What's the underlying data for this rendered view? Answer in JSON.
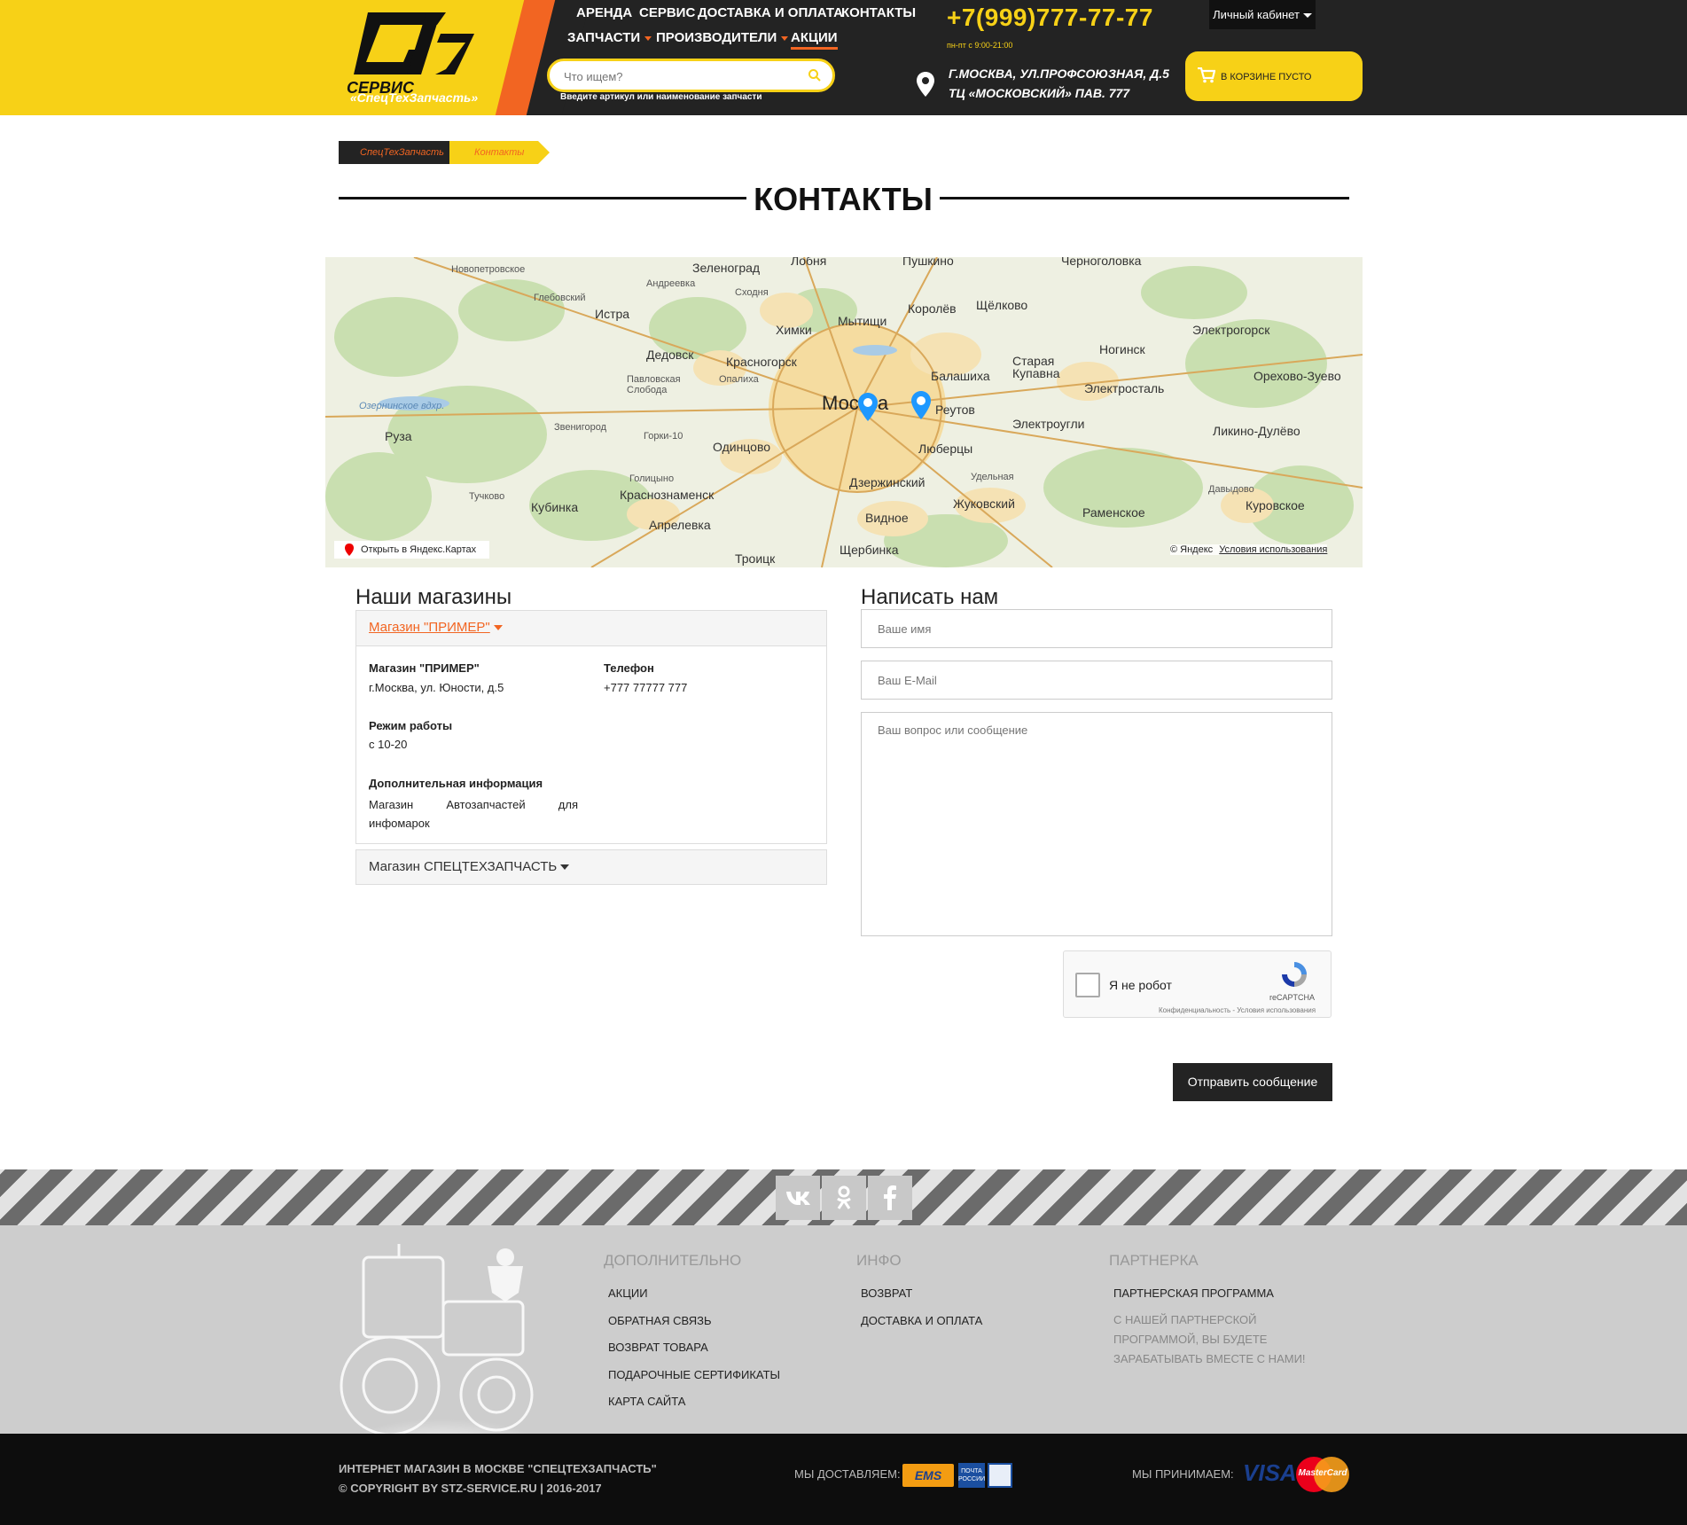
{
  "header": {
    "logo_sub": "«СпецТехЗапчасть»",
    "nav_row1": [
      "АРЕНДА",
      "СЕРВИС",
      "ДОСТАВКА И ОПЛАТА",
      "КОНТАКТЫ"
    ],
    "nav_row2": [
      "ЗАПЧАСТИ",
      "ПРОИЗВОДИТЕЛИ",
      "АКЦИИ"
    ],
    "search_placeholder": "Что ищем?",
    "search_hint": "Введите артикул или наименование запчасти",
    "phone": "+7(999)777-77-77",
    "hours": "пн-пт с 9:00-21:00",
    "address_line1": "Г.МОСКВА, УЛ.ПРОФСОЮЗНАЯ, Д.5",
    "address_line2": "ТЦ «МОСКОВСКИЙ» ПАВ. 777",
    "cabinet": "Личный кабинет",
    "cart": "В КОРЗИНЕ ПУСТО"
  },
  "breadcrumb": [
    "СпецТехЗапчасть",
    "Контакты"
  ],
  "page_title": "КОНТАКТЫ",
  "map": {
    "labels": [
      "Зеленоград",
      "Лобня",
      "Пушкино",
      "Черноголовка",
      "Новопетровское",
      "Андреевка",
      "Сходня",
      "Щёлково",
      "Королёв",
      "Глебовский",
      "Истра",
      "Химки",
      "Мытищи",
      "Электрогорск",
      "Ногинск",
      "Дедовск",
      "Красногорск",
      "Старая Купавна",
      "Балашиха",
      "Орехово-Зуево",
      "Павловская Слобода",
      "Опалиха",
      "Москва",
      "Реутов",
      "Электросталь",
      "Озернинское вдхр.",
      "Руза",
      "Звенигород",
      "Горки-10",
      "Одинцово",
      "Люберцы",
      "Электроугли",
      "Ликино-Дулёво",
      "Голицыно",
      "Дзержинский",
      "Удельная",
      "Тучково",
      "Кубинка",
      "Краснознаменск",
      "Жуковский",
      "Раменское",
      "Куровское",
      "Апрелевка",
      "Видное",
      "Щербинка",
      "Троицк",
      "Давыдово"
    ],
    "open_link": "Открыть в Яндекс.Картах",
    "copyright": "© Яндекс",
    "terms": "Условия использования"
  },
  "stores": {
    "heading": "Наши магазины",
    "store1": {
      "title": "Магазин \"ПРИМЕР\"",
      "name_label": "Магазин \"ПРИМЕР\"",
      "address": "г.Москва, ул. Юности, д.5",
      "phone_label": "Телефон",
      "phone": "+777 77777 777",
      "hours_label": "Режим работы",
      "hours": "с 10-20",
      "info_label": "Дополнительная информация",
      "info": "Магазин Автозапчастей для инфомарок"
    },
    "store2": {
      "title": "Магазин СПЕЦТЕХЗАПЧАСТЬ"
    }
  },
  "form": {
    "heading": "Написать нам",
    "name_placeholder": "Ваше имя",
    "email_placeholder": "Ваш E-Mail",
    "message_placeholder": "Ваш вопрос или сообщение",
    "captcha_label": "Я не робот",
    "captcha_brand": "reCAPTCHA",
    "captcha_fine": "Конфиденциальность - Условия использования",
    "submit": "Отправить сообщение"
  },
  "footer": {
    "social": [
      "vk-icon",
      "odnoklassniki-icon",
      "facebook-icon"
    ],
    "col1": {
      "heading": "ДОПОЛНИТЕЛЬНО",
      "links": [
        "АКЦИИ",
        "ОБРАТНАЯ СВЯЗЬ",
        "ВОЗВРАТ ТОВАРА",
        "ПОДАРОЧНЫЕ СЕРТИФИКАТЫ",
        "КАРТА САЙТА"
      ]
    },
    "col2": {
      "heading": "ИНФО",
      "links": [
        "ВОЗВРАТ",
        "ДОСТАВКА И ОПЛАТА"
      ]
    },
    "col3": {
      "heading": "ПАРТНЕРКА",
      "links": [
        "ПАРТНЕРСКАЯ ПРОГРАММА"
      ],
      "text": "С НАШЕЙ ПАРТНЕРСКОЙ ПРОГРАММОЙ, ВЫ БУДЕТЕ ЗАРАБАТЫВАТЬ ВМЕСТЕ С НАМИ!"
    },
    "shop_line": "ИНТЕРНЕТ МАГАЗИН В МОСКВЕ \"СПЕЦТЕХЗАПЧАСТЬ\"",
    "copyright": "© COPYRIGHT BY STZ-SERVICE.RU | 2016-2017",
    "delivery_label": "МЫ ДОСТАВЛЯЕМ:",
    "delivery_logo_text": "EMS",
    "post_logo_text": "ПОЧТА РОССИИ",
    "payment_label": "МЫ ПРИНИМАЕМ:",
    "visa": "VISA",
    "mastercard": "MasterCard"
  },
  "colors": {
    "brand_yellow": "#f7d117",
    "brand_orange": "#f26522",
    "dark": "#232323"
  }
}
